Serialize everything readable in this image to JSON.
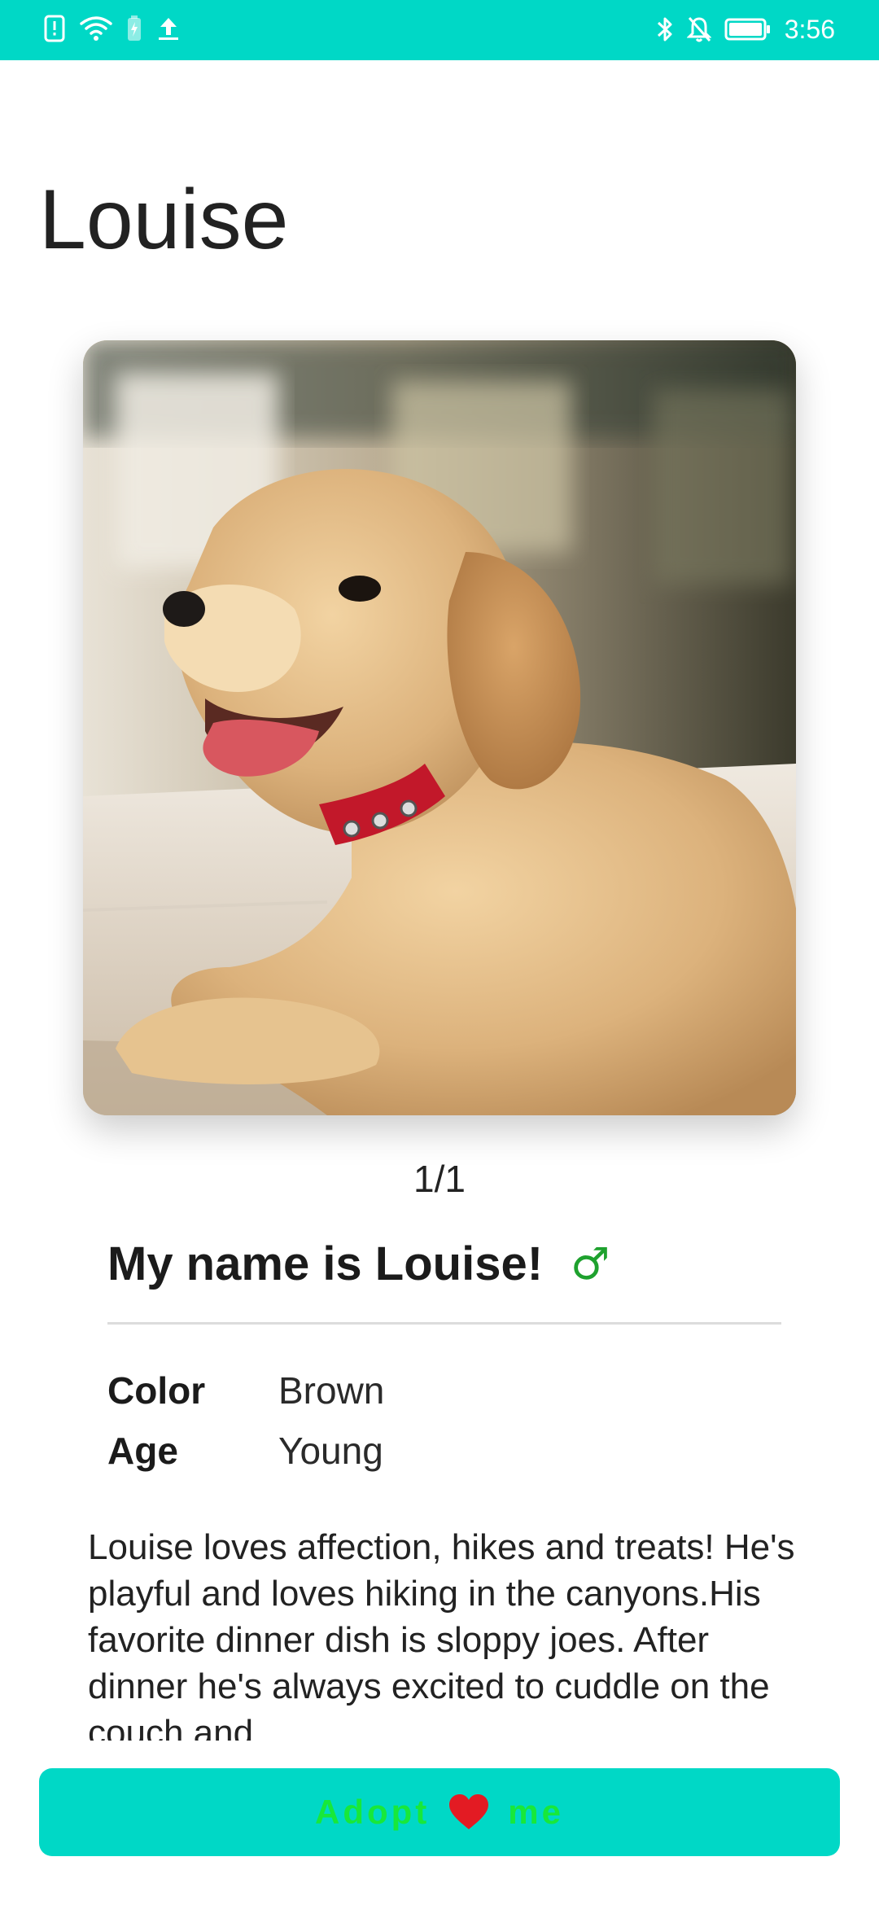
{
  "status_bar": {
    "time": "3:56",
    "left_icons": [
      "alert-icon",
      "wifi-icon",
      "battery-saver-icon",
      "upload-icon"
    ],
    "right_icons": [
      "bluetooth-icon",
      "notifications-off-icon",
      "battery-icon"
    ],
    "color": "#00d8c6"
  },
  "pet": {
    "title": "Louise",
    "photo_pager": "1/1",
    "heading": "My name is Louise!",
    "gender_symbol": "♂",
    "gender_icon": "male-icon",
    "attributes": [
      {
        "label": "Color",
        "value": "Brown"
      },
      {
        "label": "Age",
        "value": "Young"
      }
    ],
    "bio": "Louise loves affection, hikes and treats! He's playful and loves hiking in the canyons.His favorite dinner dish is sloppy joes. After dinner he's always excited to cuddle on the couch and"
  },
  "adopt_button": {
    "label_before": "Adopt",
    "icon": "heart-icon",
    "label_after": "me",
    "background": "#00d8c6",
    "text_color": "#18e83a"
  }
}
